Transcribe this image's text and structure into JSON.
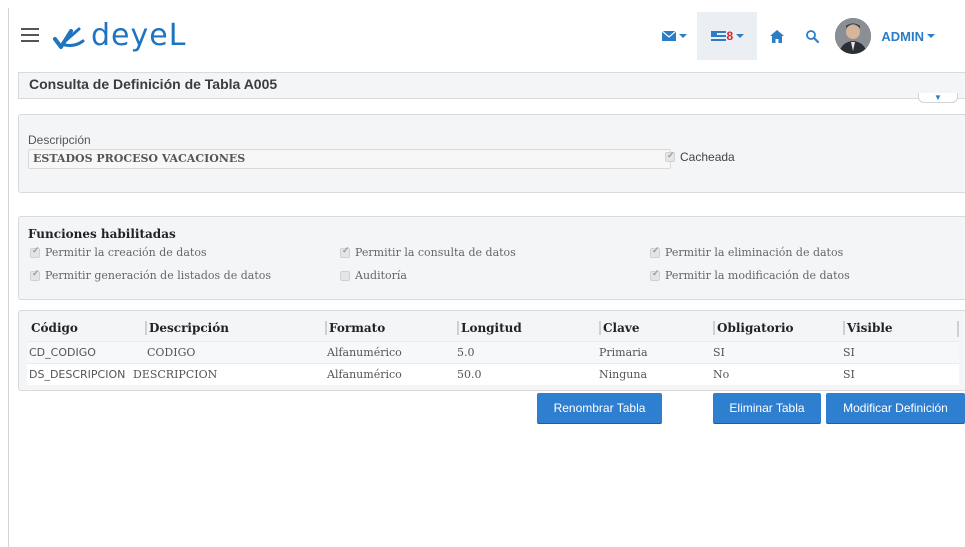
{
  "app": {
    "logo_text": "deyeL",
    "username": "ADMIN",
    "flag_badge": "8",
    "icons": [
      "menu-icon",
      "mail-icon",
      "flag-icon",
      "home-icon",
      "search-icon",
      "avatar"
    ]
  },
  "page": {
    "title": "Consulta de Definición de Tabla A005"
  },
  "form": {
    "descripcion_label": "Descripción",
    "descripcion_value": "ESTADOS PROCESO VACACIONES",
    "cacheada_label": "Cacheada",
    "cacheada_checked": true
  },
  "funciones": {
    "title": "Funciones habilitadas",
    "items": [
      {
        "label": "Permitir la creación de datos",
        "checked": true
      },
      {
        "label": "Permitir la consulta de datos",
        "checked": true
      },
      {
        "label": "Permitir la eliminación de datos",
        "checked": true
      },
      {
        "label": "Permitir generación de listados de datos",
        "checked": true
      },
      {
        "label": "Auditoría",
        "checked": false
      },
      {
        "label": "Permitir la modificación de datos",
        "checked": true
      }
    ]
  },
  "grid": {
    "headers": [
      "Código",
      "Descripción",
      "Formato",
      "Longitud",
      "Clave",
      "Obligatorio",
      "Visible"
    ],
    "rows": [
      [
        "CD_CODIGO",
        "CODIGO",
        "Alfanumérico",
        "5.0",
        "Primaria",
        "SI",
        "SI"
      ],
      [
        "DS_DESCRIPCION",
        "DESCRIPCION",
        "Alfanumérico",
        "50.0",
        "Ninguna",
        "No",
        "SI"
      ]
    ]
  },
  "buttons": {
    "rename": "Renombrar Tabla",
    "delete": "Eliminar Tabla",
    "modify": "Modificar Definición"
  },
  "colors": {
    "brand": "#1f74bf",
    "button": "#2f7fd0",
    "panel_bg": "#f4f5f6",
    "badge": "#d9262e"
  }
}
